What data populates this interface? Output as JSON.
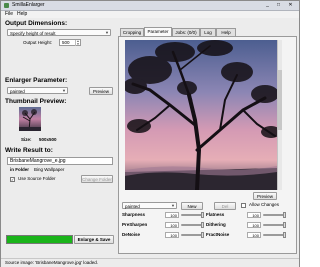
{
  "window": {
    "title": "SmillaEnlarger",
    "min_glyph": "_",
    "max_glyph": "□",
    "close_glyph": "✕"
  },
  "menu": [
    "File",
    "Help"
  ],
  "left": {
    "output_dimensions": {
      "heading": "Output Dimensions:",
      "mode": "Specify height of result",
      "height_label": "Output Height:",
      "height_value": "500"
    },
    "enlarger_parameter": {
      "heading": "Enlarger Parameter:",
      "preset": "painted",
      "preview_button": "Preview"
    },
    "thumbnail_preview": {
      "heading": "Thumbnail Preview:",
      "size_label": "Size:",
      "size_value": "500x500"
    },
    "write_result": {
      "heading": "Write Result to:",
      "filename": "BrisbaneMangrove_e.jpg",
      "in_folder_label": "in Folder",
      "folder_name": "Bing Wallpaper",
      "use_source_folder_label": "Use Source Folder",
      "use_source_folder_checked": true,
      "change_folder_button": "Change Folder"
    },
    "progress": 1.0,
    "enlarge_button": "Enlarge & Save"
  },
  "status": "Source image: 'BrisbaneMangrove.jpg' loaded.",
  "tabs": [
    "Cropping",
    "Parameter",
    "Jobs: (0/0)",
    "Log",
    "Help"
  ],
  "active_tab": "Parameter",
  "parameter_panel": {
    "preview_button": "Preview",
    "preset": "painted",
    "new_button": "New",
    "del_button": "Del",
    "allow_changes_label": "Allow Changes",
    "allow_changes_checked": false,
    "sliders": [
      {
        "name": "Sharpness",
        "value": 100
      },
      {
        "name": "PreSharpen",
        "value": 100
      },
      {
        "name": "DeNoise",
        "value": 100
      },
      {
        "name": "Flatness",
        "value": 100
      },
      {
        "name": "Dithering",
        "value": 100
      },
      {
        "name": "FractNoise",
        "value": 100
      }
    ]
  }
}
